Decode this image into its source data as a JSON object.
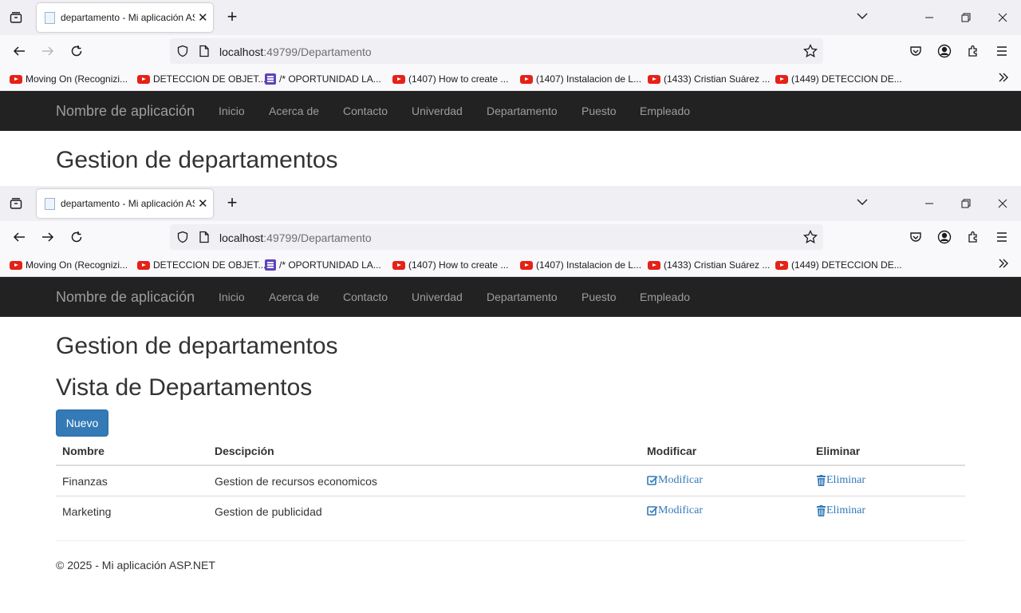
{
  "browser": {
    "tab_title": "departamento - Mi aplicación ASP.NET",
    "url_host": "localhost",
    "url_rest": ":49799/Departamento",
    "bookmarks": [
      {
        "label": "Moving On (Recognizi...",
        "icon": "youtube-icon"
      },
      {
        "label": "DETECCION DE OBJET...",
        "icon": "youtube-icon"
      },
      {
        "label": "/* OPORTUNIDAD LA...",
        "icon": "forms-icon"
      },
      {
        "label": "(1407) How to create ...",
        "icon": "youtube-icon"
      },
      {
        "label": "(1407) Instalacion de L...",
        "icon": "youtube-icon"
      },
      {
        "label": "(1433) Cristian Suárez ...",
        "icon": "youtube-icon"
      },
      {
        "label": "(1449) DETECCION DE...",
        "icon": "youtube-icon"
      }
    ]
  },
  "app": {
    "brand": "Nombre de aplicación",
    "nav": [
      "Inicio",
      "Acerca de",
      "Contacto",
      "Univerdad",
      "Departamento",
      "Puesto",
      "Empleado"
    ],
    "page_heading": "Gestion de departamentos",
    "view_heading": "Vista de Departamentos",
    "new_button": "Nuevo",
    "table": {
      "headers": [
        "Nombre",
        "Descipción",
        "Modificar",
        "Eliminar"
      ],
      "rows": [
        {
          "nombre": "Finanzas",
          "descripcion": "Gestion de recursos economicos",
          "modificar": "Modificar",
          "eliminar": "Eliminar"
        },
        {
          "nombre": "Marketing",
          "descripcion": "Gestion de publicidad",
          "modificar": "Modificar",
          "eliminar": "Eliminar"
        }
      ]
    },
    "footer": "© 2025 - Mi aplicación ASP.NET"
  },
  "colors": {
    "navbar_bg": "#222222",
    "link": "#337ab7",
    "primary_button": "#337ab7"
  }
}
